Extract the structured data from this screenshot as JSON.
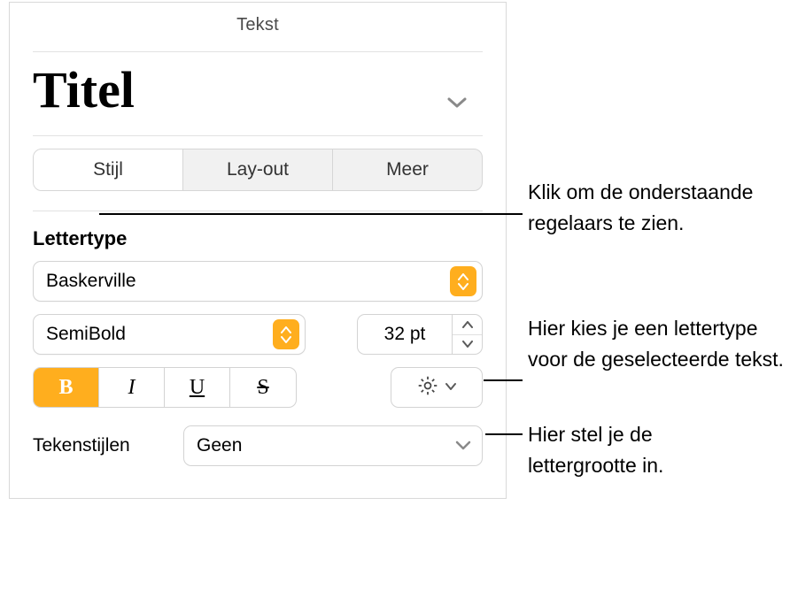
{
  "panel": {
    "title": "Tekst",
    "paragraph_style": "Titel",
    "tabs": [
      "Stijl",
      "Lay-out",
      "Meer"
    ],
    "active_tab_index": 0,
    "font_section_label": "Lettertype",
    "font_family": "Baskerville",
    "font_weight": "SemiBold",
    "font_size": "32 pt",
    "style_glyphs": {
      "bold": "B",
      "italic": "I",
      "underline": "U",
      "strike": "S"
    },
    "char_styles_label": "Tekenstijlen",
    "char_style_value": "Geen"
  },
  "callouts": {
    "tabs": "Klik om de onderstaande regelaars te zien.",
    "font": "Hier kies je een lettertype voor de geselecteerde tekst.",
    "size": "Hier stel je de lettergrootte in."
  }
}
